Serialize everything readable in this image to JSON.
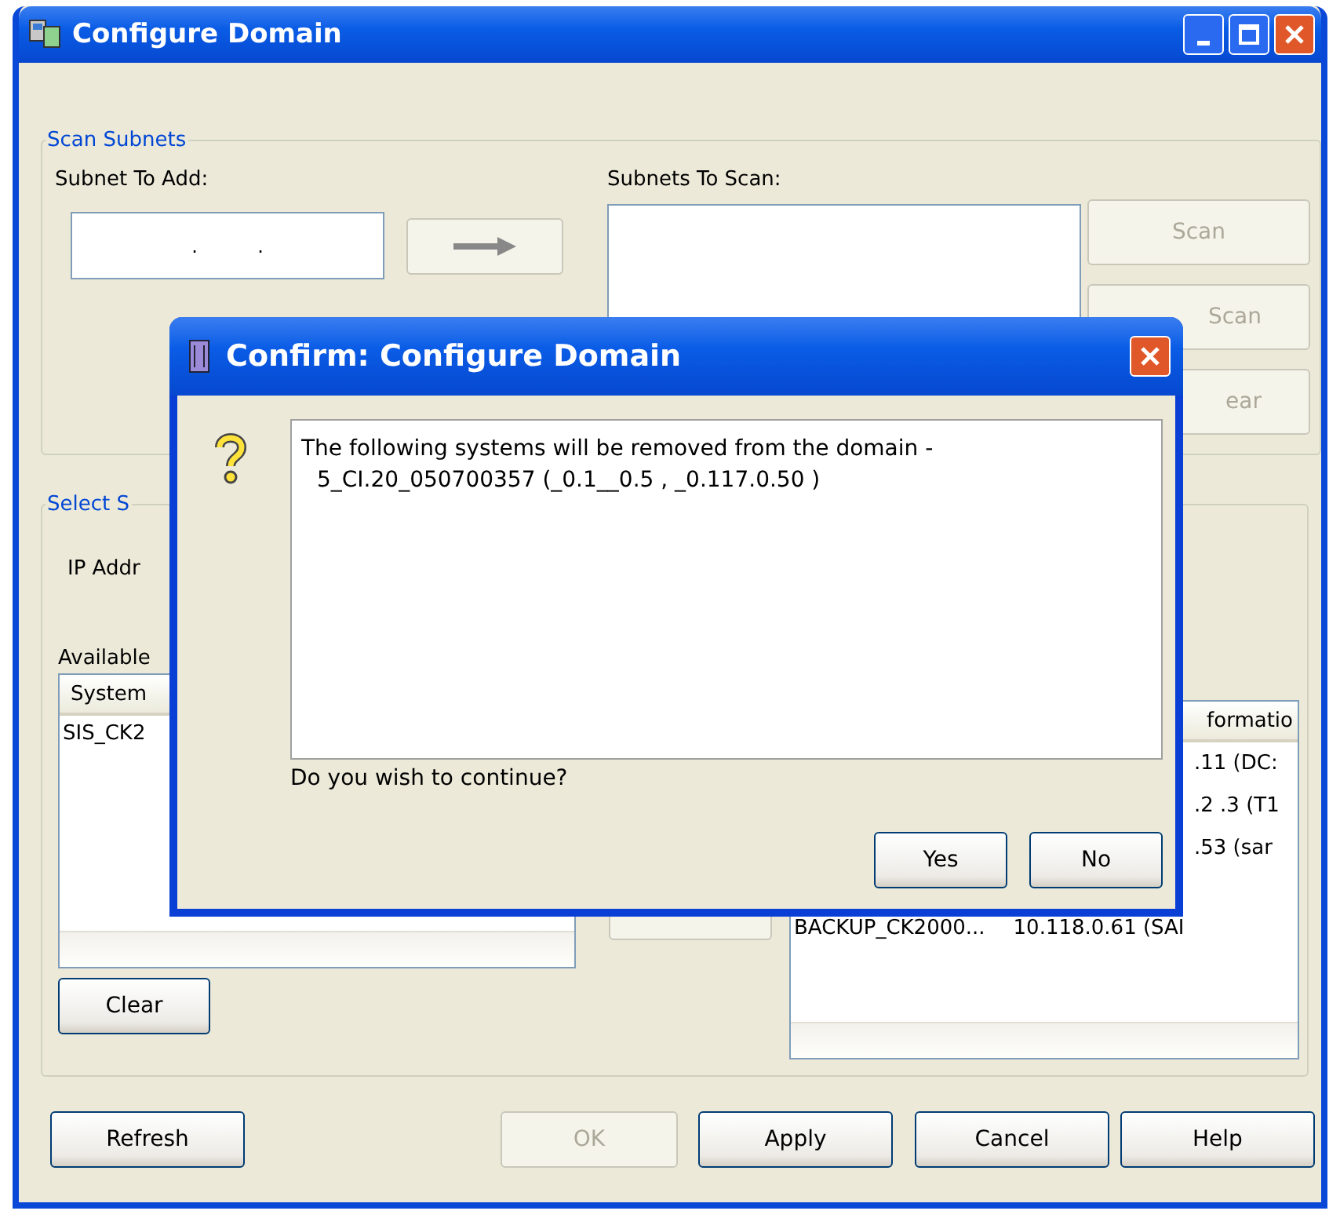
{
  "window": {
    "title": "Configure Domain"
  },
  "scan_subnets": {
    "legend": "Scan Subnets",
    "subnet_label": "Subnet To Add:",
    "subnet_value": ".          .",
    "subnets_label": "Subnets To Scan:",
    "buttons": [
      {
        "label": "Scan",
        "disabled": true
      },
      {
        "label": "Scan",
        "disabled": true
      },
      {
        "label": "ear",
        "disabled": true
      }
    ]
  },
  "select_systems": {
    "legend": "Select S",
    "ip_label": "IP Addr",
    "available_label": "Available",
    "available_header": "System",
    "available_rows": [
      "SIS_CK2"
    ],
    "clear_button": "Clear",
    "right_header": "formatio",
    "right_rows": [
      {
        "kind": "tail",
        "column_2": ".11 (DC:"
      },
      {
        "kind": "tail",
        "column_2": ".2 .3 (T1"
      },
      {
        "kind": "tail",
        "column_2": ".53 (sar"
      },
      {
        "kind": "full",
        "column_1": "BACKUP_CK2000...",
        "column_2": "10.118.0.61 (SAI"
      }
    ]
  },
  "buttons": [
    {
      "label": "Refresh",
      "disabled": false
    },
    {
      "label": "OK",
      "disabled": true
    },
    {
      "label": "Apply",
      "disabled": false
    },
    {
      "label": "Cancel",
      "disabled": false
    },
    {
      "label": "Help",
      "disabled": false
    }
  ],
  "dialog": {
    "title": "Confirm: Configure Domain",
    "message_lines": [
      "The following systems will be removed from the domain -",
      "5_CI.20_050700357 (_0.1__0.5 , _0.117.0.50 )"
    ],
    "question": "Do you wish to continue?",
    "buttons": [
      "Yes",
      "No"
    ]
  }
}
